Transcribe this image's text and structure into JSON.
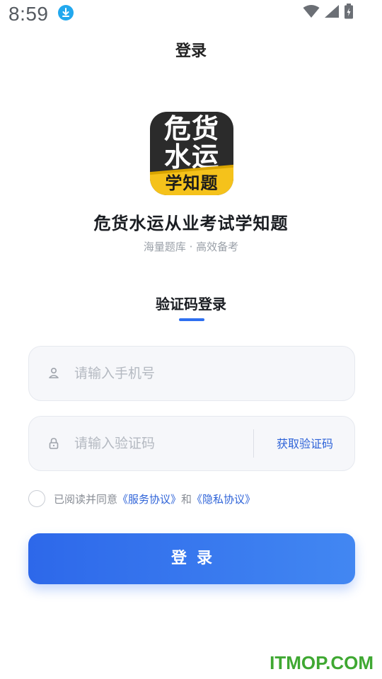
{
  "status_bar": {
    "time": "8:59",
    "icons": [
      "download-icon",
      "wifi-icon",
      "signal-icon",
      "battery-charging-icon"
    ]
  },
  "nav": {
    "title": "登录"
  },
  "app": {
    "logo_lines": [
      "危货",
      "水运",
      "学知题"
    ],
    "name": "危货水运从业考试学知题",
    "slogan": "海量题库 · 高效备考"
  },
  "tabs": {
    "active": "验证码登录"
  },
  "form": {
    "phone": {
      "placeholder": "请输入手机号",
      "value": "",
      "icon": "user-icon"
    },
    "code": {
      "placeholder": "请输入验证码",
      "value": "",
      "icon": "lock-icon"
    },
    "get_code_label": "获取验证码"
  },
  "agreement": {
    "checked": false,
    "prefix": "已阅读并同意",
    "service_link": "《服务协议》",
    "and": "和",
    "privacy_link": "《隐私协议》"
  },
  "login_button": {
    "label": "登录"
  },
  "watermark": "ITMOP.COM",
  "colors": {
    "accent": "#2e6ff0",
    "link": "#2e63d8",
    "logo_band": "#f5c21b",
    "watermark": "#3fa832"
  }
}
